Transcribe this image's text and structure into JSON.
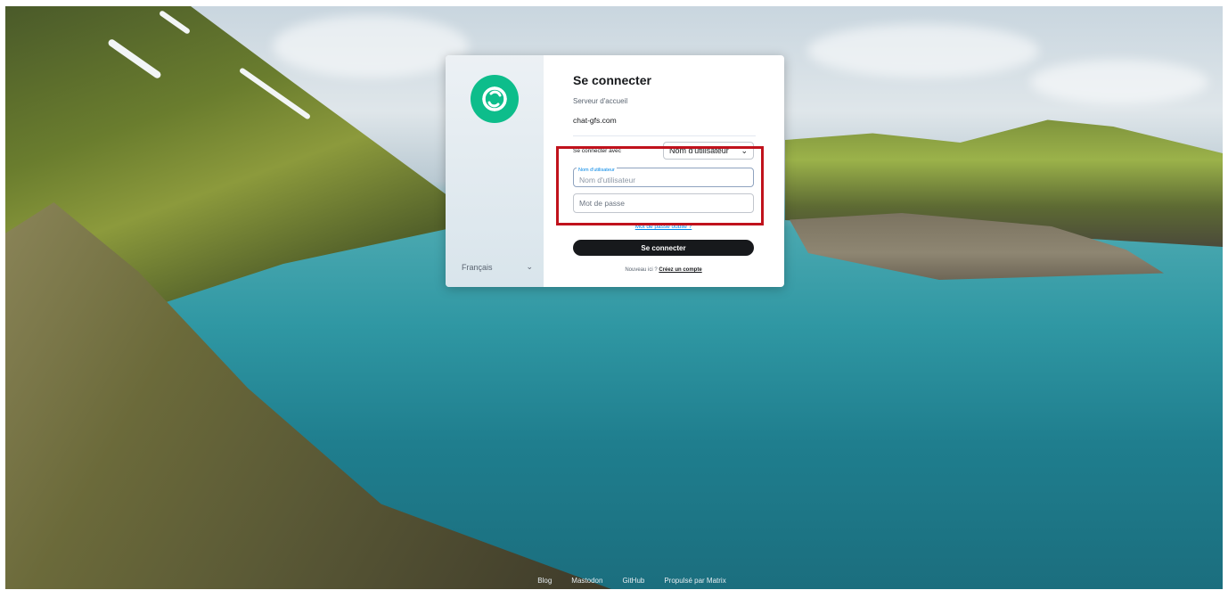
{
  "login": {
    "title": "Se connecter",
    "homeserver_label": "Serveur d'accueil",
    "homeserver_value": "chat-gfs.com",
    "login_with_label": "Se connecter avec",
    "login_with_value": "Nom d'utilisateur",
    "username_label": "Nom d'utilisateur",
    "username_placeholder": "Nom d'utilisateur",
    "password_placeholder": "Mot de passe",
    "forgot_password": "Mot de passe oublié ?",
    "submit_label": "Se connecter",
    "new_here_text": "Nouveau ici ?",
    "create_account_link": "Créez un compte"
  },
  "language": {
    "selected": "Français"
  },
  "footer": {
    "links": [
      "Blog",
      "Mastodon",
      "GitHub",
      "Propulsé par Matrix"
    ]
  },
  "icons": {
    "logo": "element-logo-icon",
    "dropdown": "chevron-down-icon"
  },
  "colors": {
    "brand": "#0dbd8b",
    "button": "#17191c",
    "highlight": "#c0121c",
    "link": "#0086e6"
  }
}
